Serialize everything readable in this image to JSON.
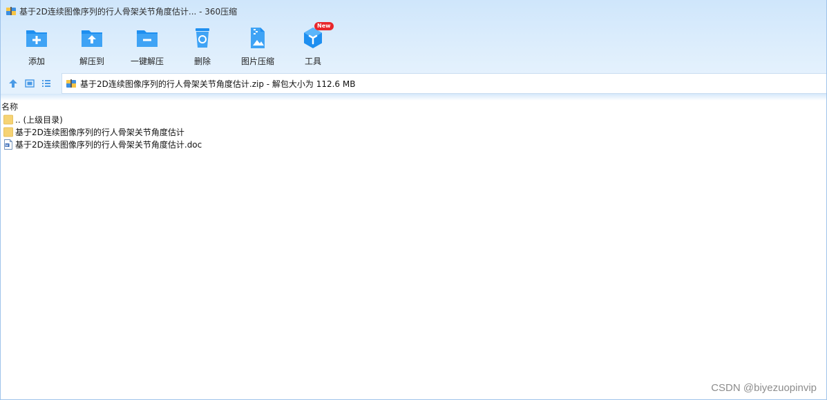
{
  "window": {
    "title": "基于2D连续图像序列的行人骨架关节角度估计... - 360压缩"
  },
  "toolbar": {
    "items": [
      {
        "label": "添加",
        "icon": "add-folder-icon"
      },
      {
        "label": "解压到",
        "icon": "extract-to-icon"
      },
      {
        "label": "一键解压",
        "icon": "one-click-extract-icon"
      },
      {
        "label": "删除",
        "icon": "trash-icon"
      },
      {
        "label": "图片压缩",
        "icon": "image-compress-icon"
      },
      {
        "label": "工具",
        "icon": "tools-cube-icon",
        "badge": "New"
      }
    ]
  },
  "address": {
    "text": "基于2D连续图像序列的行人骨架关节角度估计.zip - 解包大小为 112.6 MB"
  },
  "filelist": {
    "column_name": "名称",
    "rows": [
      {
        "name": ".. (上级目录)",
        "type": "parent-folder"
      },
      {
        "name": "基于2D连续图像序列的行人骨架关节角度估计",
        "type": "folder"
      },
      {
        "name": "基于2D连续图像序列的行人骨架关节角度估计.doc",
        "type": "doc"
      }
    ]
  },
  "watermark": "CSDN @biyezuopinvip",
  "colors": {
    "accent_blue": "#1e8ff0",
    "toolbar_bg": "#d8ebfc",
    "folder_yellow": "#f6d374",
    "badge_red": "#e8262b"
  }
}
